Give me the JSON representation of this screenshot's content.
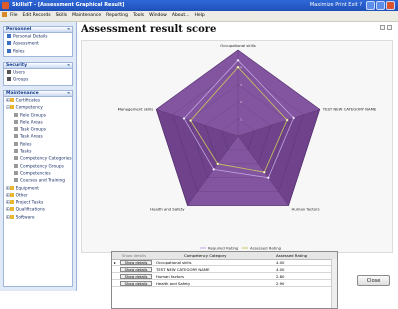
{
  "window": {
    "title": "SkillsIT - [Assessment Graphical Result]",
    "tray_text": "Maximize    Print    Exit    ?"
  },
  "menu": [
    "File",
    "Edit Records",
    "Skills",
    "Maintenance",
    "Reporting",
    "Tools",
    "Window",
    "About...",
    "Help"
  ],
  "sidebar": {
    "panels": [
      {
        "title": "Personnel",
        "items": [
          {
            "label": "Personal Details",
            "icon_color": "#3a6fc4"
          },
          {
            "label": "Assessment",
            "icon_color": "#3a6fc4"
          },
          {
            "label": "Roles",
            "icon_color": "#3a6fc4"
          }
        ]
      },
      {
        "title": "Security",
        "items": [
          {
            "label": "Users",
            "icon_color": "#555555"
          },
          {
            "label": "Groups",
            "icon_color": "#555555"
          }
        ]
      },
      {
        "title": "Maintenance",
        "items": [
          {
            "label": "Certificates",
            "icon_color": "#e8b830"
          },
          {
            "label": "Competency",
            "icon_color": "#e8b830"
          },
          {
            "label": "Role Groups",
            "icon_color": "#9a9a9a"
          },
          {
            "label": "Role Areas",
            "icon_color": "#9a9a9a"
          },
          {
            "label": "Task Groups",
            "icon_color": "#9a9a9a"
          },
          {
            "label": "Task Areas",
            "icon_color": "#9a9a9a"
          },
          {
            "label": "Roles",
            "icon_color": "#9a9a9a"
          },
          {
            "label": "Tasks",
            "icon_color": "#9a9a9a"
          },
          {
            "label": "Competency Categories",
            "icon_color": "#9a9a9a"
          },
          {
            "label": "Competency Groups",
            "icon_color": "#9a9a9a"
          },
          {
            "label": "Competencies",
            "icon_color": "#9a9a9a"
          },
          {
            "label": "Courses and Training",
            "icon_color": "#9a9a9a"
          },
          {
            "label": "Equipment",
            "icon_color": "#e8b830"
          },
          {
            "label": "Other",
            "icon_color": "#e8b830"
          },
          {
            "label": "Project Tasks",
            "icon_color": "#e8b830"
          },
          {
            "label": "Qualifications",
            "icon_color": "#e8b830"
          },
          {
            "label": "Software",
            "icon_color": "#e8b830"
          }
        ]
      }
    ]
  },
  "main": {
    "heading": "Assessment result score",
    "close_label": "Close"
  },
  "chart_data": {
    "type": "radar",
    "categories": [
      "Occupational skills",
      "TEST NEW CATEGORY NAME",
      "Human factors",
      "Health and Safety",
      "Management skills"
    ],
    "rmax": 5,
    "series": [
      {
        "name": "Required Rating",
        "color": "#c0a6e0",
        "values": [
          4.4,
          3.4,
          3.0,
          2.4,
          3.3
        ]
      },
      {
        "name": "Assessed Rating",
        "color": "#c9c85a",
        "values": [
          4.0,
          3.0,
          2.6,
          2.0,
          2.9
        ]
      }
    ],
    "fill_color": "#7c4a9b",
    "legend": "bottom"
  },
  "grid": {
    "columns": [
      "Show details",
      "Competency Category",
      "Assessed Rating"
    ],
    "button_label": "Show details",
    "rows": [
      {
        "category": "Occupational skills",
        "rating": "4.00"
      },
      {
        "category": "TEST NEW CATEGORY NAME",
        "rating": "4.00"
      },
      {
        "category": "Human factors",
        "rating": "2.80"
      },
      {
        "category": "Health and Safety",
        "rating": "2.90"
      }
    ]
  }
}
